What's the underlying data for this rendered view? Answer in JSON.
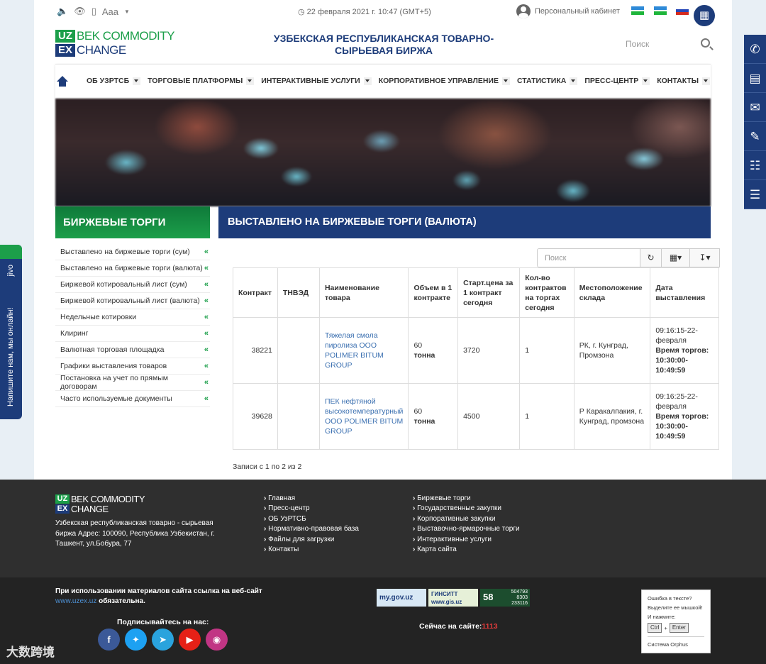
{
  "topbar": {
    "font_size_label": "Aaa",
    "date": "22 февраля 2021 г. 10:47 (GMT+5)",
    "cabinet": "Персональный кабинет"
  },
  "header": {
    "logo_uz": "UZ",
    "logo_ex": "EX",
    "logo_line1": "BEK COMMODITY",
    "logo_line2": "CHANGE",
    "title": "УЗБЕКСКАЯ РЕСПУБЛИКАНСКАЯ ТОВАРНО-СЫРЬЕВАЯ БИРЖА",
    "search_label": "Поиск"
  },
  "nav": [
    "ОБ УЗРТСБ",
    "ТОРГОВЫЕ ПЛАТФОРМЫ",
    "ИНТЕРАКТИВНЫЕ УСЛУГИ",
    "КОРПОРАТИВНОЕ УПРАВЛЕНИЕ",
    "СТАТИСТИКА",
    "ПРЕСС-ЦЕНТР",
    "КОНТАКТЫ"
  ],
  "section_left": "БИРЖЕВЫЕ ТОРГИ",
  "section_right": "ВЫСТАВЛЕНО НА БИРЖЕВЫЕ ТОРГИ (ВАЛЮТА)",
  "sidebar": [
    "Выставлено на биржевые торги (сум)",
    "Выставлено на биржевые торги (валюта)",
    "Биржевой котировальный лист (сум)",
    "Биржевой котировальный лист (валюта)",
    "Недельные котировки",
    "Клиринг",
    "Валютная торговая площадка",
    "Графики выставления товаров",
    "Постановка на учет по прямым договорам",
    "Часто используемые документы"
  ],
  "table": {
    "search_placeholder": "Поиск",
    "headers": [
      "Контракт",
      "ТНВЭД",
      "Наименование товара",
      "Объем в 1 контракте",
      "Старт.цена за 1 контракт сегодня",
      "Кол-во контрактов на торгах сегодня",
      "Местоположение склада",
      "Дата выставления"
    ],
    "rows": [
      {
        "contract": "38221",
        "tnved": "",
        "name": "Тяжелая смола пиролиза ООО POLIMER BITUM GROUP",
        "volume": "60",
        "unit": "тонна",
        "price": "3720",
        "count": "1",
        "location": "РК, г. Кунград, Промзона",
        "date": "09:16:15-22-февраля",
        "time_label": "Время торгов: 10:30:00-10:49:59"
      },
      {
        "contract": "39628",
        "tnved": "",
        "name": "ПЕК нефтяной высокотемпературный ООО POLIMER BITUM GROUP",
        "volume": "60",
        "unit": "тонна",
        "price": "4500",
        "count": "1",
        "location": "Р Каракалпакия, г. Кунград, промзона",
        "date": "09:16:25-22-февраля",
        "time_label": "Время торгов: 10:30:00-10:49:59"
      }
    ],
    "records": "Записи с 1 по 2 из 2"
  },
  "footer": {
    "address": "Узбекская республиканская товарно - сырьевая биржа Адрес: 100090, Республика Узбекистан, г. Ташкент, ул.Бобура, 77",
    "col1": [
      "Главная",
      "Пресс-центр",
      "ОБ УзРТСБ",
      "Нормативно-правовая база",
      "Файлы для загрузки",
      "Контакты"
    ],
    "col2": [
      "Биржевые торги",
      "Государственные закупки",
      "Корпоративные закупки",
      "Выставочно-ярмарочные торги",
      "Интерактивные услуги",
      "Карта сайта"
    ],
    "note_pre": "При использовании материалов сайта ссылка на веб-сайт",
    "note_link": "www.uzex.uz",
    "note_post": "обязательна.",
    "follow": "Подписывайтесь на нас:",
    "online_label": "Сейчас на сайте:",
    "online_count": "1113",
    "badge_gov": "my.gov.uz",
    "badge_gis_1": "ГИНСИТТ",
    "badge_gis_2": "www.gis.uz",
    "counter_big": "58",
    "counter_1": "504793",
    "counter_2": "8303",
    "counter_3": "233116",
    "orphus_1": "Ошибка в тексте?",
    "orphus_2": "Выделите ее мышкой!",
    "orphus_3": "И нажмите:",
    "orphus_ctrl": "Ctrl",
    "orphus_enter": "Enter",
    "orphus_sys": "Система Orphus"
  },
  "jivo": {
    "label": "Напишите нам, мы онлайн!",
    "brand": "jivo"
  },
  "watermark": "大数跨境"
}
